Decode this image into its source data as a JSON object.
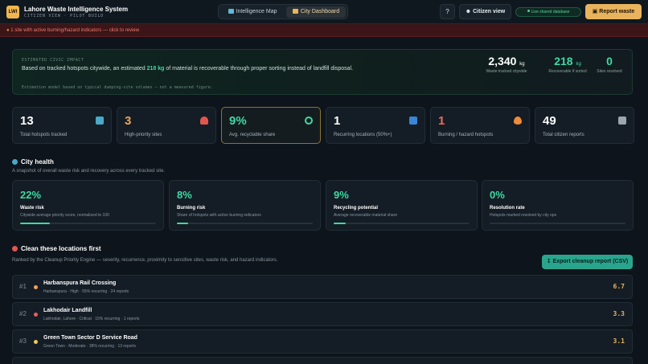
{
  "header": {
    "logo": "LWI",
    "title": "Lahore Waste Intelligence System",
    "subtitle": "CITIZEN VIEW · PILOT BUILD",
    "tabs": [
      {
        "label": "Intelligence Map",
        "active": false
      },
      {
        "label": "City Dashboard",
        "active": true
      }
    ],
    "help_label": "?",
    "citizen_view_label": "Citizen view",
    "db_badge": "Live shared database",
    "report_button": "Report waste"
  },
  "alert": {
    "text": "1 site with active burning/hazard indicators — click to review"
  },
  "impact": {
    "kicker": "ESTIMATED CIVIC IMPACT",
    "text_before": "Based on tracked hotspots citywide, an estimated ",
    "highlight": "218 kg",
    "text_after": " of material is recoverable through proper sorting instead of landfill disposal.",
    "note": "Estimation model based on typical dumping-site volumes — not a measured figure.",
    "stats": [
      {
        "value": "2,340",
        "unit": "kg",
        "label": "Waste tracked citywide"
      },
      {
        "value": "218",
        "unit": "kg",
        "label": "Recoverable if sorted"
      },
      {
        "value": "0",
        "unit": "",
        "label": "Sites resolved"
      }
    ]
  },
  "kpis": [
    {
      "value": "13",
      "label": "Total hotspots tracked",
      "icon": "map-icon",
      "color": "#ffffff"
    },
    {
      "value": "3",
      "label": "High-priority sites",
      "icon": "warning-icon",
      "color": "#f0a35a"
    },
    {
      "value": "9%",
      "label": "Avg. recyclable share",
      "icon": "recycle-icon",
      "color": "#3fd9a3"
    },
    {
      "value": "1",
      "label": "Recurring locations (50%+)",
      "icon": "repeat-icon",
      "color": "#ffffff"
    },
    {
      "value": "1",
      "label": "Burning / hazard hotspots",
      "icon": "flame-icon",
      "color": "#ef6a5b"
    },
    {
      "value": "49",
      "label": "Total citizen reports",
      "icon": "document-icon",
      "color": "#ffffff"
    }
  ],
  "city_health": {
    "title": "City health",
    "subtitle": "A snapshot of overall waste risk and recovery across every tracked site.",
    "cards": [
      {
        "value": "22%",
        "label": "Waste risk",
        "desc": "Citywide average priority score, normalized to 100",
        "progress": 0.22,
        "color": "#3fd9a3"
      },
      {
        "value": "8%",
        "label": "Burning risk",
        "desc": "Share of hotspots with active burning indicators",
        "progress": 0.08,
        "color": "#3fd9a3"
      },
      {
        "value": "9%",
        "label": "Recycling potential",
        "desc": "Average recoverable material share",
        "progress": 0.09,
        "color": "#3fd9a3"
      },
      {
        "value": "0%",
        "label": "Resolution rate",
        "desc": "Hotspots marked resolved by city ops",
        "progress": 0.0,
        "color": "#3fd9a3"
      }
    ]
  },
  "priority": {
    "title": "Clean these locations first",
    "subtitle": "Ranked by the Cleanup Priority Engine — severity, recurrence, proximity to sensitive sites, waste risk, and hazard indicators.",
    "export_label": "Export cleanup report (CSV)",
    "rows": [
      {
        "rank": "#1",
        "name": "Harbanspura Rail Crossing",
        "details": "Harbanspura · High · 55% recurring · 24 reports",
        "score": "6.7",
        "dot": "#f0a35a"
      },
      {
        "rank": "#2",
        "name": "Lakhodair Landfill",
        "details": "Lakhodair, Lahore · Critical · 15% recurring · 1 reports",
        "score": "3.3",
        "dot": "#ef5b5b"
      },
      {
        "rank": "#3",
        "name": "Green Town Sector D Service Road",
        "details": "Green Town · Moderate · 38% recurring · 13 reports",
        "score": "3.1",
        "dot": "#f0c95a"
      }
    ]
  }
}
